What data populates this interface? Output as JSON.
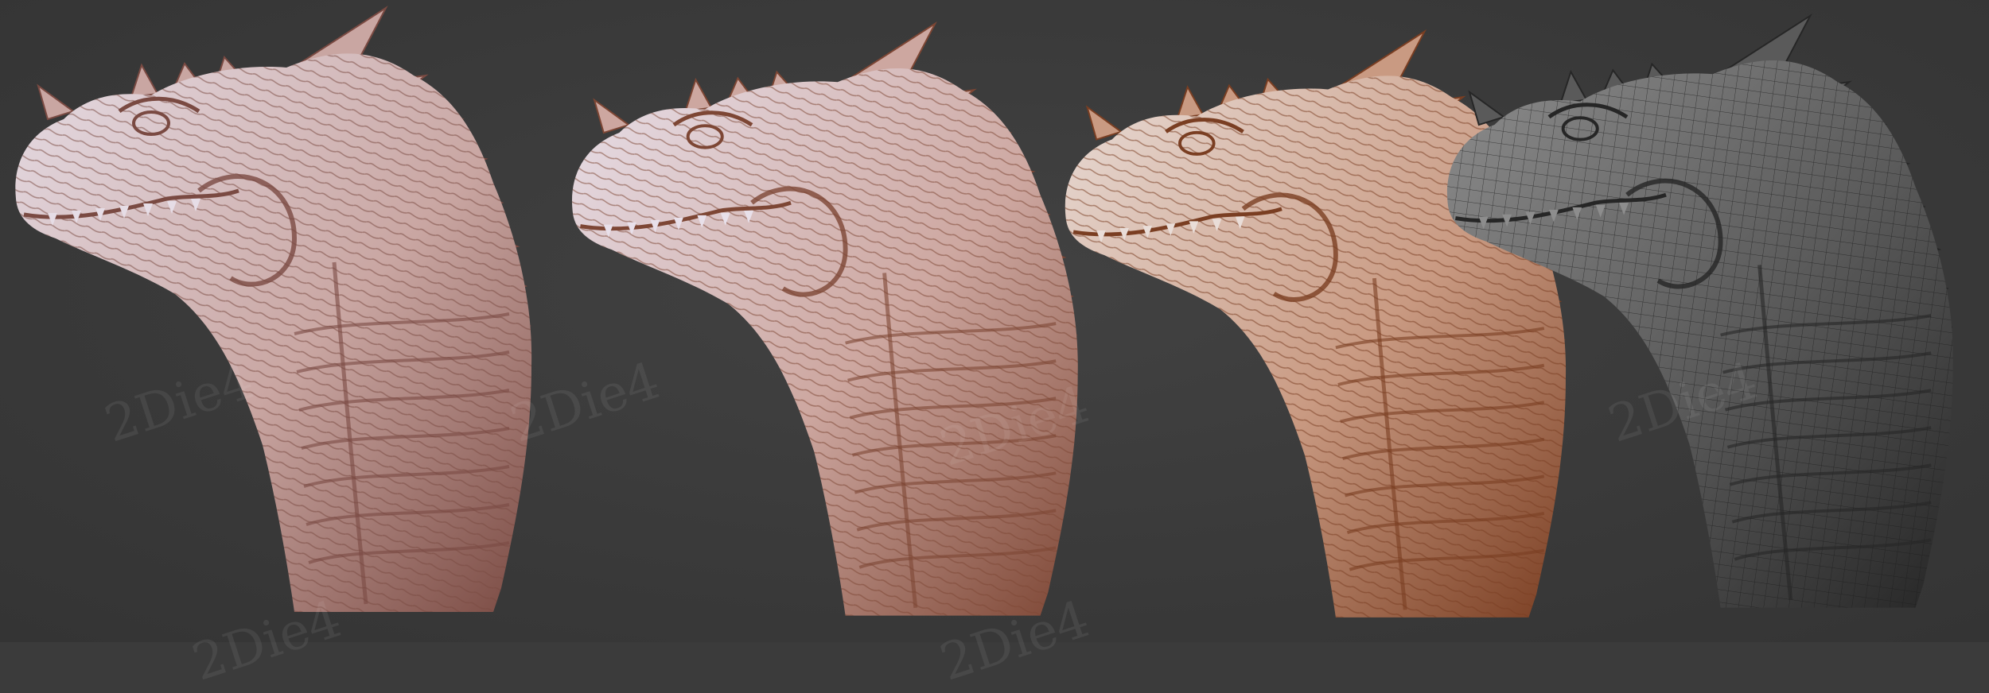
{
  "scene": {
    "background_color": "#3b3b3b",
    "watermark_text": "2Die4",
    "panels": [
      {
        "name": "sculpt-view-1",
        "material": "clay-pink",
        "base_color": "#c9a6a2",
        "shadow_color": "#7a4a42",
        "highlight_color": "#e6dde6"
      },
      {
        "name": "sculpt-view-2",
        "material": "clay-pink",
        "base_color": "#cda7a0",
        "shadow_color": "#7d4634",
        "highlight_color": "#e8e0ea"
      },
      {
        "name": "sculpt-view-3",
        "material": "clay-orange",
        "base_color": "#c99a82",
        "shadow_color": "#7a3e22",
        "highlight_color": "#e9ddd8"
      },
      {
        "name": "wireframe-view",
        "material": "gray-wireframe",
        "base_color": "#5a5a5a",
        "shadow_color": "#262626",
        "highlight_color": "#8d8d8d"
      }
    ]
  }
}
